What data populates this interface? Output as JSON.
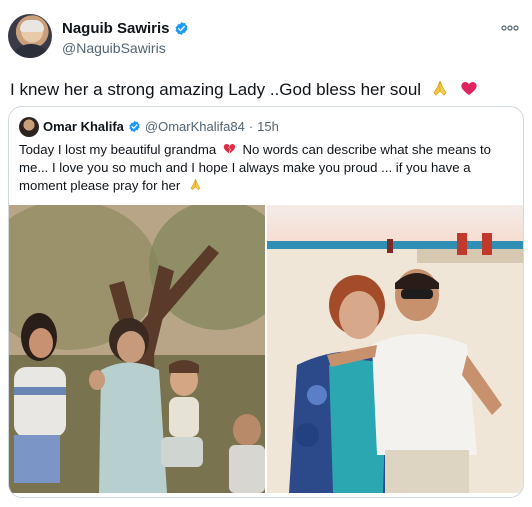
{
  "author": {
    "display_name": "Naguib Sawiris",
    "handle": "@NaguibSawiris"
  },
  "tweet": {
    "text": "I knew her a strong amazing Lady ..God bless her soul"
  },
  "quoted": {
    "display_name": "Omar Khalifa",
    "handle": "@OmarKhalifa84",
    "separator": "·",
    "time": "15h",
    "text_part1": "Today I lost my beautiful grandma",
    "text_part2": "No words can describe what she means to me... I love you so much and I hope I always make you proud ... if you have a moment please pray for her"
  },
  "icons": {
    "verified": "verified-badge-icon",
    "more": "more-dots-icon",
    "pray": "pray-emoji",
    "heart": "red-heart-emoji",
    "broken_heart": "broken-heart-emoji"
  },
  "colors": {
    "verified_blue": "#1d9bf0",
    "heart_red": "#e0245e"
  }
}
